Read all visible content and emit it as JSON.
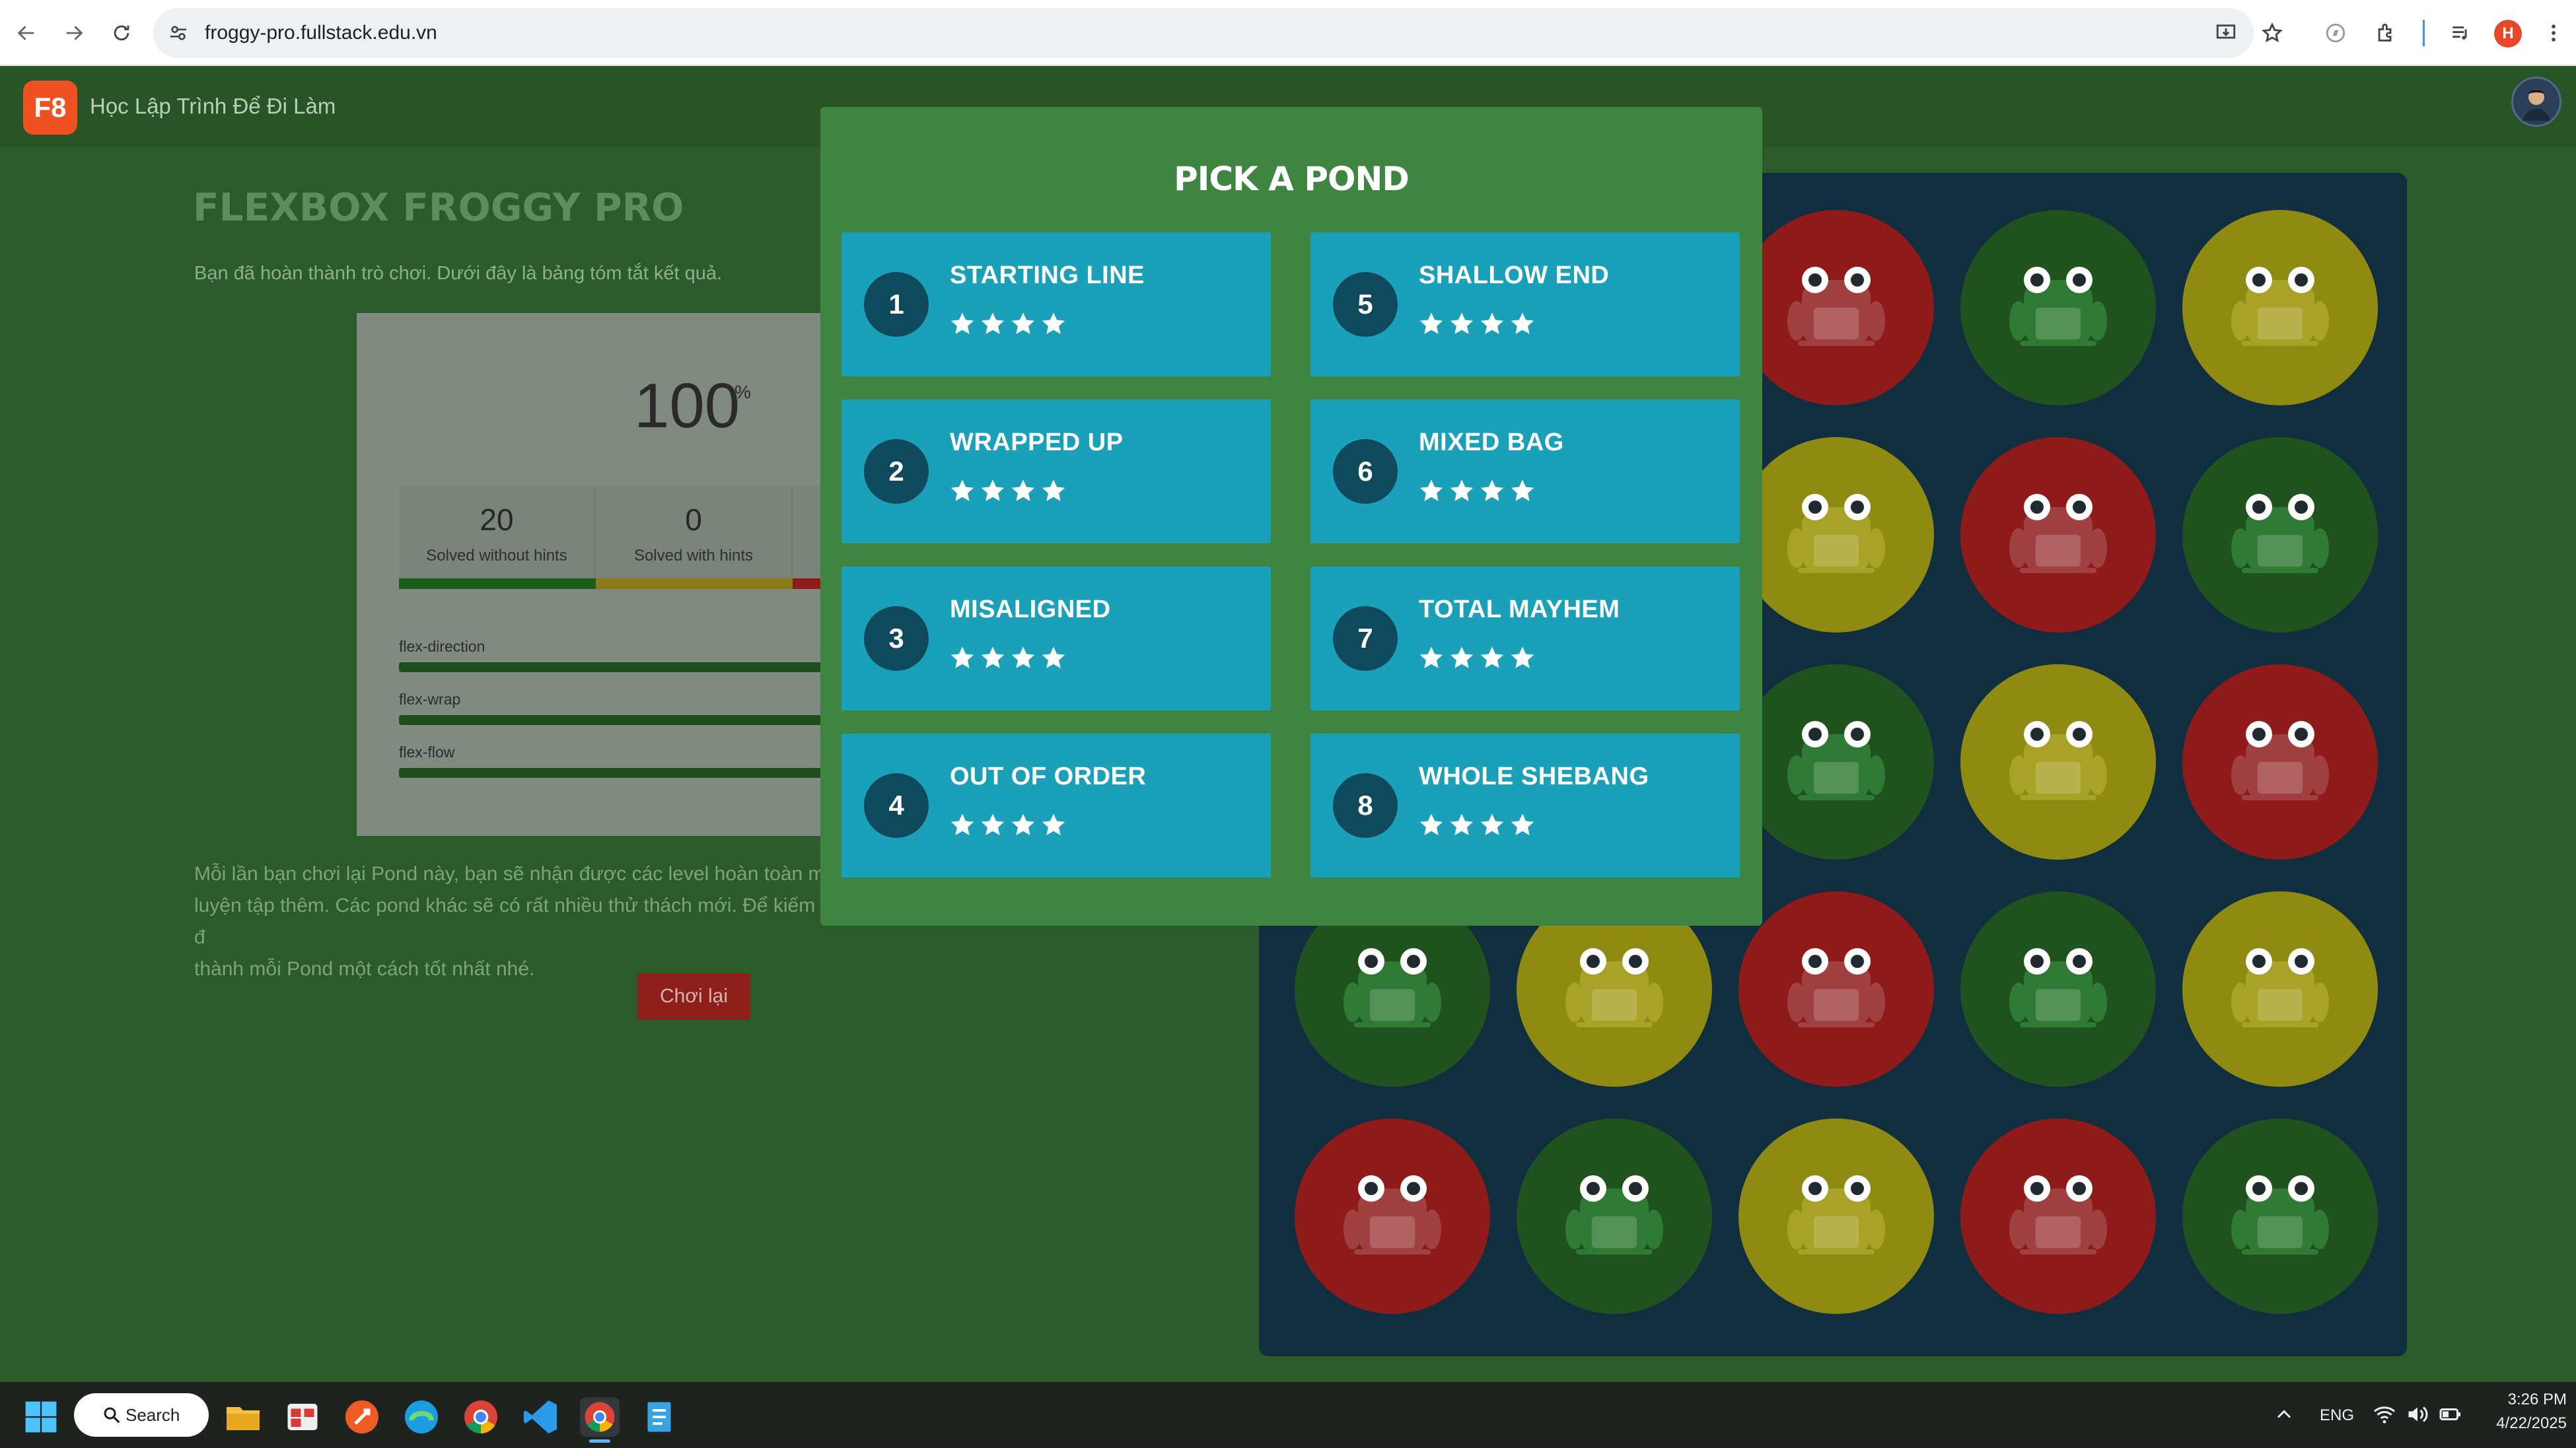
{
  "browser": {
    "url": "froggy-pro.fullstack.edu.vn",
    "profile_initial": "H"
  },
  "header": {
    "logo_text": "F8",
    "brand": "Học Lập Trình Để Đi Làm"
  },
  "summary": {
    "title": "FLEXBOX FROGGY PRO",
    "subtitle": "Bạn đã hoàn thành trò chơi. Dưới đây là bảng tóm tắt kết quả.",
    "percent": "100",
    "percent_sign": "%",
    "progress": 1.0,
    "stats": [
      {
        "value": "20",
        "label": "Solved without hints",
        "color": "#1b5e1b"
      },
      {
        "value": "0",
        "label": "Solved with hints",
        "color": "#8a7a1a"
      }
    ],
    "bars": [
      {
        "label": "flex-direction"
      },
      {
        "label": "flex-wrap"
      },
      {
        "label": "flex-flow"
      }
    ],
    "bottom_text_1": "Mỗi lần bạn chơi lại Pond này, bạn sẽ nhận được các level hoàn toàn m",
    "bottom_text_2": "luyện tập thêm. Các pond khác sẽ có rất nhiều thử thách mới. Để kiếm đ",
    "bottom_text_3": "thành mỗi Pond một cách tốt nhất nhé.",
    "replay_button": "Chơi lại"
  },
  "modal": {
    "title": "PICK A POND",
    "ponds": [
      {
        "number": "1",
        "name": "STARTING LINE",
        "stars": 4
      },
      {
        "number": "2",
        "name": "WRAPPED UP",
        "stars": 4
      },
      {
        "number": "3",
        "name": "MISALIGNED",
        "stars": 4
      },
      {
        "number": "4",
        "name": "OUT OF ORDER",
        "stars": 4
      },
      {
        "number": "5",
        "name": "SHALLOW END",
        "stars": 4
      },
      {
        "number": "6",
        "name": "MIXED BAG",
        "stars": 4
      },
      {
        "number": "7",
        "name": "TOTAL MAYHEM",
        "stars": 4
      },
      {
        "number": "8",
        "name": "WHOLE SHEBANG",
        "stars": 4
      }
    ]
  },
  "pond_board": {
    "colors": {
      "red": "#8e1a1a",
      "green": "#1f521f",
      "yellow": "#8e8a12"
    },
    "rows": [
      [
        "green",
        "yellow",
        "red",
        "green",
        "yellow"
      ],
      [
        "red",
        "green",
        "yellow",
        "red",
        "green"
      ],
      [
        "yellow",
        "red",
        "green",
        "yellow",
        "red"
      ],
      [
        "green",
        "yellow",
        "red",
        "green",
        "yellow"
      ],
      [
        "red",
        "green",
        "yellow",
        "red",
        "green"
      ]
    ]
  },
  "taskbar": {
    "search_label": "Search",
    "language": "ENG",
    "time": "3:26 PM",
    "date": "4/22/2025"
  }
}
